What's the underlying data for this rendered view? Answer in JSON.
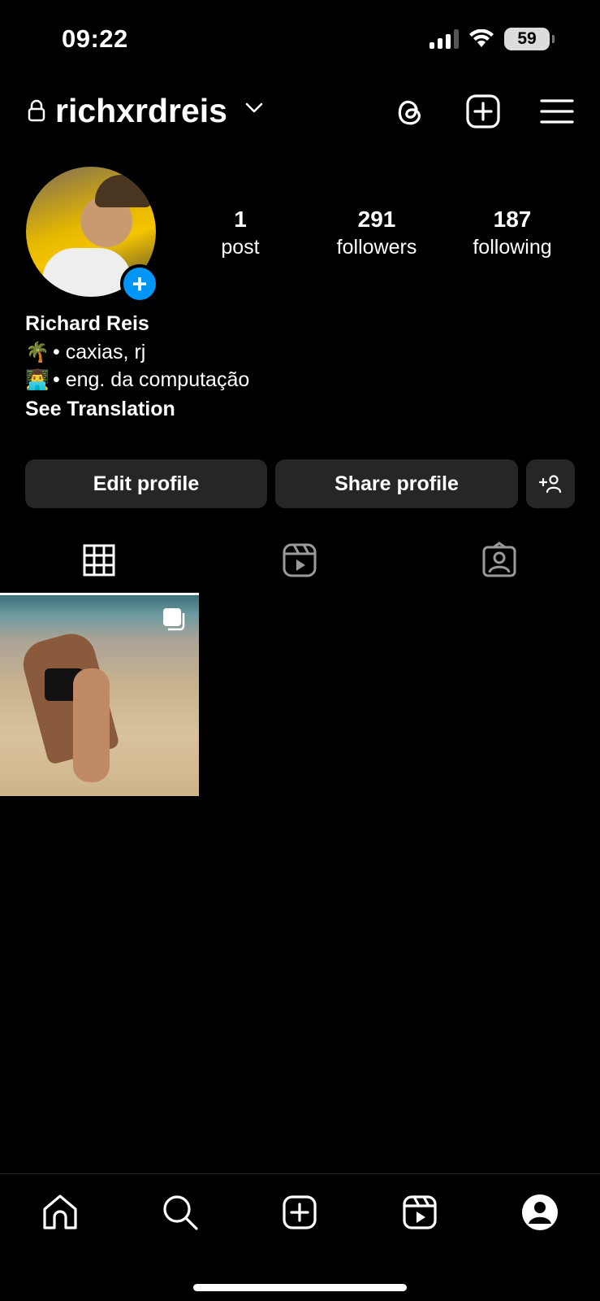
{
  "status_bar": {
    "time": "09:22",
    "battery": "59"
  },
  "header": {
    "username": "richxrdreis",
    "private": true
  },
  "profile": {
    "display_name": "Richard Reis",
    "bio": [
      {
        "emoji": "🌴",
        "text": "• caxias, rj"
      },
      {
        "emoji": "👨‍💻",
        "text": "• eng. da computação"
      }
    ],
    "see_translation": "See Translation"
  },
  "stats": {
    "posts": {
      "count": "1",
      "label": "post"
    },
    "followers": {
      "count": "291",
      "label": "followers"
    },
    "following": {
      "count": "187",
      "label": "following"
    }
  },
  "actions": {
    "edit_label": "Edit profile",
    "share_label": "Share profile"
  },
  "tabs": {
    "active": "grid"
  },
  "icons": {
    "header": [
      "lock-icon",
      "chevron-down-icon",
      "threads-icon",
      "new-post-icon",
      "menu-icon"
    ],
    "tabs": [
      "grid-icon",
      "reels-icon",
      "tagged-icon"
    ],
    "nav": [
      "home-icon",
      "search-icon",
      "create-icon",
      "reels-icon",
      "profile-icon"
    ]
  },
  "colors": {
    "background": "#000000",
    "button_bg": "#262626",
    "accent": "#0095f6"
  }
}
